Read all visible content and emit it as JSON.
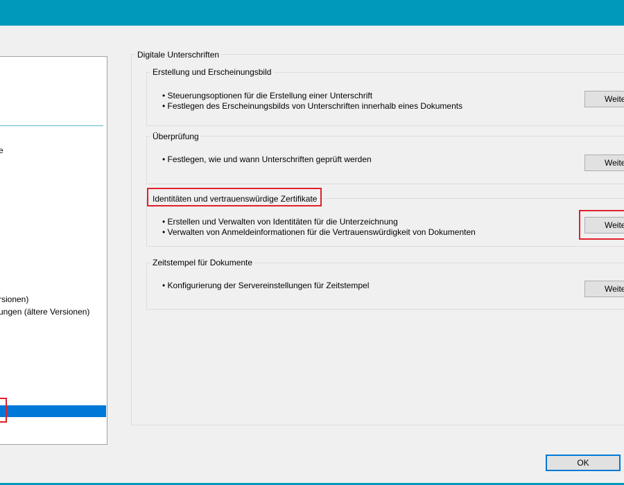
{
  "sidebar": {
    "items": [
      {
        "label": "e"
      },
      {
        "label": "rsionen)"
      },
      {
        "label": "ungen (ältere Versionen)"
      }
    ]
  },
  "main": {
    "frame_title": "Digitale Unterschriften",
    "sections": [
      {
        "title": "Erstellung und Erscheinungsbild",
        "bullets": [
          "• Steuerungsoptionen für die Erstellung einer Unterschrift",
          "• Festlegen des Erscheinungsbilds von Unterschriften innerhalb eines Dokuments"
        ],
        "button_label": "Weite"
      },
      {
        "title": "Überprüfung",
        "bullets": [
          "• Festlegen, wie und wann Unterschriften geprüft werden"
        ],
        "button_label": "Weite"
      },
      {
        "title": "Identitäten und vertrauenswürdige Zertifikate",
        "bullets": [
          "• Erstellen und Verwalten von Identitäten für die Unterzeichnung",
          "• Verwalten von Anmeldeinformationen für die Vertrauenswürdigkeit von Dokumenten"
        ],
        "button_label": "Weite"
      },
      {
        "title": "Zeitstempel für Dokumente",
        "bullets": [
          "• Konfigurierung der Servereinstellungen für Zeitstempel"
        ],
        "button_label": "Weite"
      }
    ]
  },
  "footer": {
    "ok_label": "OK"
  },
  "colors": {
    "titlebar": "#0099bc",
    "selection": "#0078d7",
    "highlight": "#e0202a"
  }
}
